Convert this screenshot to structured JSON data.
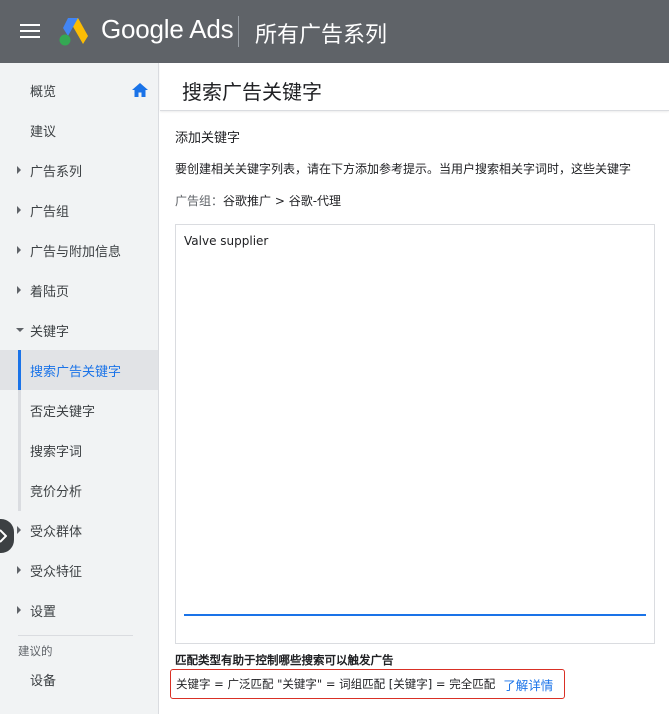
{
  "header": {
    "brand": "Google Ads",
    "title": "所有广告系列"
  },
  "sidebar": {
    "items": [
      {
        "label": "概览"
      },
      {
        "label": "建议"
      },
      {
        "label": "广告系列"
      },
      {
        "label": "广告组"
      },
      {
        "label": "广告与附加信息"
      },
      {
        "label": "着陆页"
      },
      {
        "label": "关键字"
      },
      {
        "label": "搜索广告关键字"
      },
      {
        "label": "否定关键字"
      },
      {
        "label": "搜索字词"
      },
      {
        "label": "竞价分析"
      },
      {
        "label": "受众群体"
      },
      {
        "label": "受众特征"
      },
      {
        "label": "设置"
      }
    ],
    "section_label": "建议的",
    "section_items": [
      {
        "label": "设备"
      }
    ]
  },
  "main": {
    "page_title": "搜索广告关键字",
    "section_title": "添加关键字",
    "description": "要创建相关关键字列表，请在下方添加参考提示。当用户搜索相关字词时，这些关键字",
    "ad_group_prefix": "广告组：",
    "ad_group_value": "谷歌推广 > 谷歌-代理",
    "keywords_value": "Valve supplier",
    "match_title": "匹配类型有助于控制哪些搜索可以触发广告",
    "match_text": "关键字 = 广泛匹配  \"关键字\" = 词组匹配  [关键字] = 完全匹配",
    "learn_more": "了解详情"
  },
  "colors": {
    "header_bg": "#5f6368",
    "accent": "#1a73e8",
    "highlight_border": "#d93025",
    "sidebar_bg": "#f1f3f4"
  }
}
